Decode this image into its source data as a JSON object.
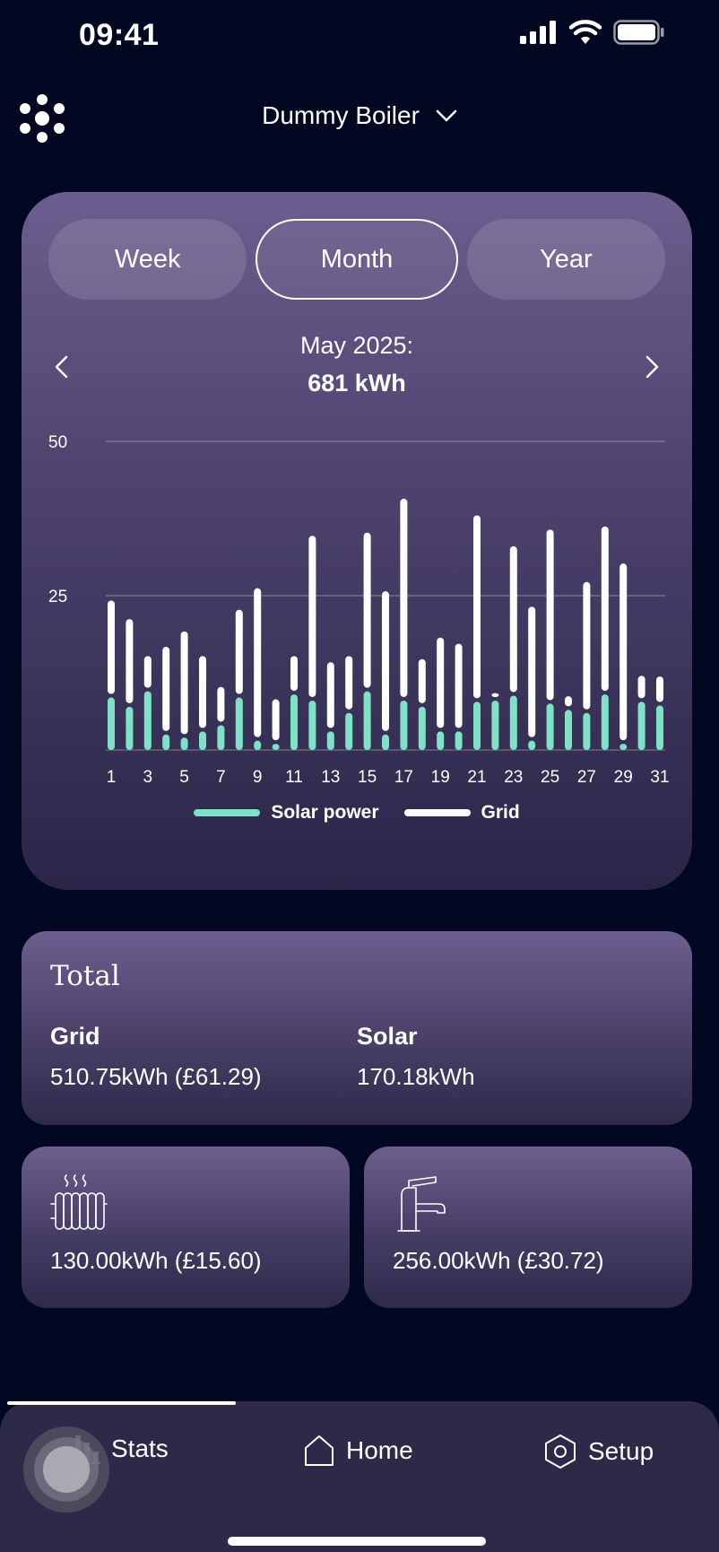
{
  "status_bar": {
    "time": "09:41"
  },
  "header": {
    "device_name": "Dummy Boiler"
  },
  "period_tabs": [
    {
      "label": "Week",
      "active": false
    },
    {
      "label": "Month",
      "active": true
    },
    {
      "label": "Year",
      "active": false
    }
  ],
  "period": {
    "label": "May 2025:",
    "total": "681 kWh"
  },
  "chart_data": {
    "type": "bar",
    "stacked": true,
    "categories": [
      1,
      2,
      3,
      4,
      5,
      6,
      7,
      8,
      9,
      10,
      11,
      12,
      13,
      14,
      15,
      16,
      17,
      18,
      19,
      20,
      21,
      22,
      23,
      24,
      25,
      26,
      27,
      28,
      29,
      30,
      31
    ],
    "x_tick_labels": [
      "1",
      "3",
      "5",
      "7",
      "9",
      "11",
      "13",
      "15",
      "17",
      "19",
      "21",
      "23",
      "25",
      "27",
      "29",
      "31"
    ],
    "y_tick_labels": [
      "25",
      "50"
    ],
    "ylim": [
      0,
      50
    ],
    "series": [
      {
        "name": "Solar power",
        "color": "#7ee3c6",
        "values": [
          8.5,
          7.0,
          9.5,
          2.5,
          2.0,
          3.0,
          4.0,
          8.5,
          1.5,
          1.0,
          9.0,
          8.0,
          3.0,
          6.0,
          9.5,
          2.5,
          8.0,
          7.0,
          3.0,
          3.0,
          7.8,
          8.0,
          8.8,
          1.5,
          7.5,
          6.5,
          6.0,
          9.0,
          1.0,
          7.8,
          7.2
        ]
      },
      {
        "name": "Grid",
        "color": "#ffffff",
        "values": [
          16.0,
          14.5,
          6.0,
          14.5,
          17.5,
          12.5,
          6.5,
          14.5,
          25.0,
          7.5,
          6.5,
          27.0,
          11.5,
          9.5,
          26.0,
          23.5,
          33.0,
          8.0,
          15.5,
          14.5,
          30.5,
          1.5,
          24.5,
          22.0,
          28.5,
          2.5,
          21.5,
          27.5,
          29.5,
          4.5,
          5.0
        ]
      }
    ],
    "grid": true,
    "legend_placement": "bottom-center"
  },
  "legend": [
    {
      "label": "Solar power"
    },
    {
      "label": "Grid"
    }
  ],
  "totals": {
    "title": "Total",
    "grid_label": "Grid",
    "grid_value": "510.75kWh (£61.29)",
    "solar_label": "Solar",
    "solar_value": "170.18kWh"
  },
  "usage_cards": {
    "heating": {
      "icon": "radiator-icon",
      "value": "130.00kWh (£15.60)"
    },
    "hot_water": {
      "icon": "tap-icon",
      "value": "256.00kWh (£30.72)"
    }
  },
  "bottom_nav": [
    {
      "label": "Stats",
      "icon": "stats-icon",
      "active": true
    },
    {
      "label": "Home",
      "icon": "home-icon",
      "active": false
    },
    {
      "label": "Setup",
      "icon": "gear-icon",
      "active": false
    }
  ]
}
